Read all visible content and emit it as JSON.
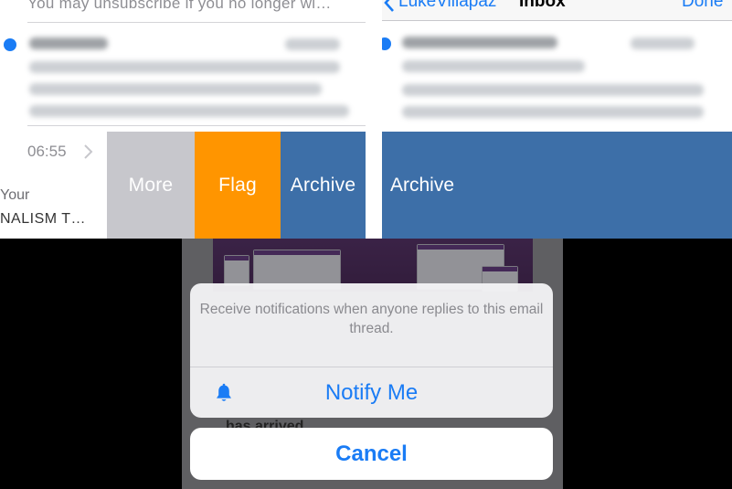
{
  "left_panel": {
    "unsubscribe_line": "You may unsubscribe if you no longer wi…",
    "time": "06:55",
    "snippet_line1": "Your",
    "snippet_line2": "NALISM T…",
    "actions": {
      "more": "More",
      "flag": "Flag",
      "archive": "Archive"
    },
    "colors": {
      "more": "#c7c7cc",
      "flag": "#ff9500",
      "archive": "#3d6fa8",
      "unread_dot": "#1a7cf5"
    }
  },
  "right_panel": {
    "nav": {
      "back_label": "LukeVillapaz",
      "title": "Inbox",
      "done_label": "Done"
    },
    "action": {
      "archive": "Archive"
    }
  },
  "action_sheet": {
    "message": "Receive notifications when anyone replies to this email thread.",
    "notify_label": "Notify Me",
    "cancel_label": "Cancel",
    "background_text": "has arrived",
    "icons": {
      "notify": "bell-icon"
    },
    "accent_color": "#1a7cf5"
  }
}
